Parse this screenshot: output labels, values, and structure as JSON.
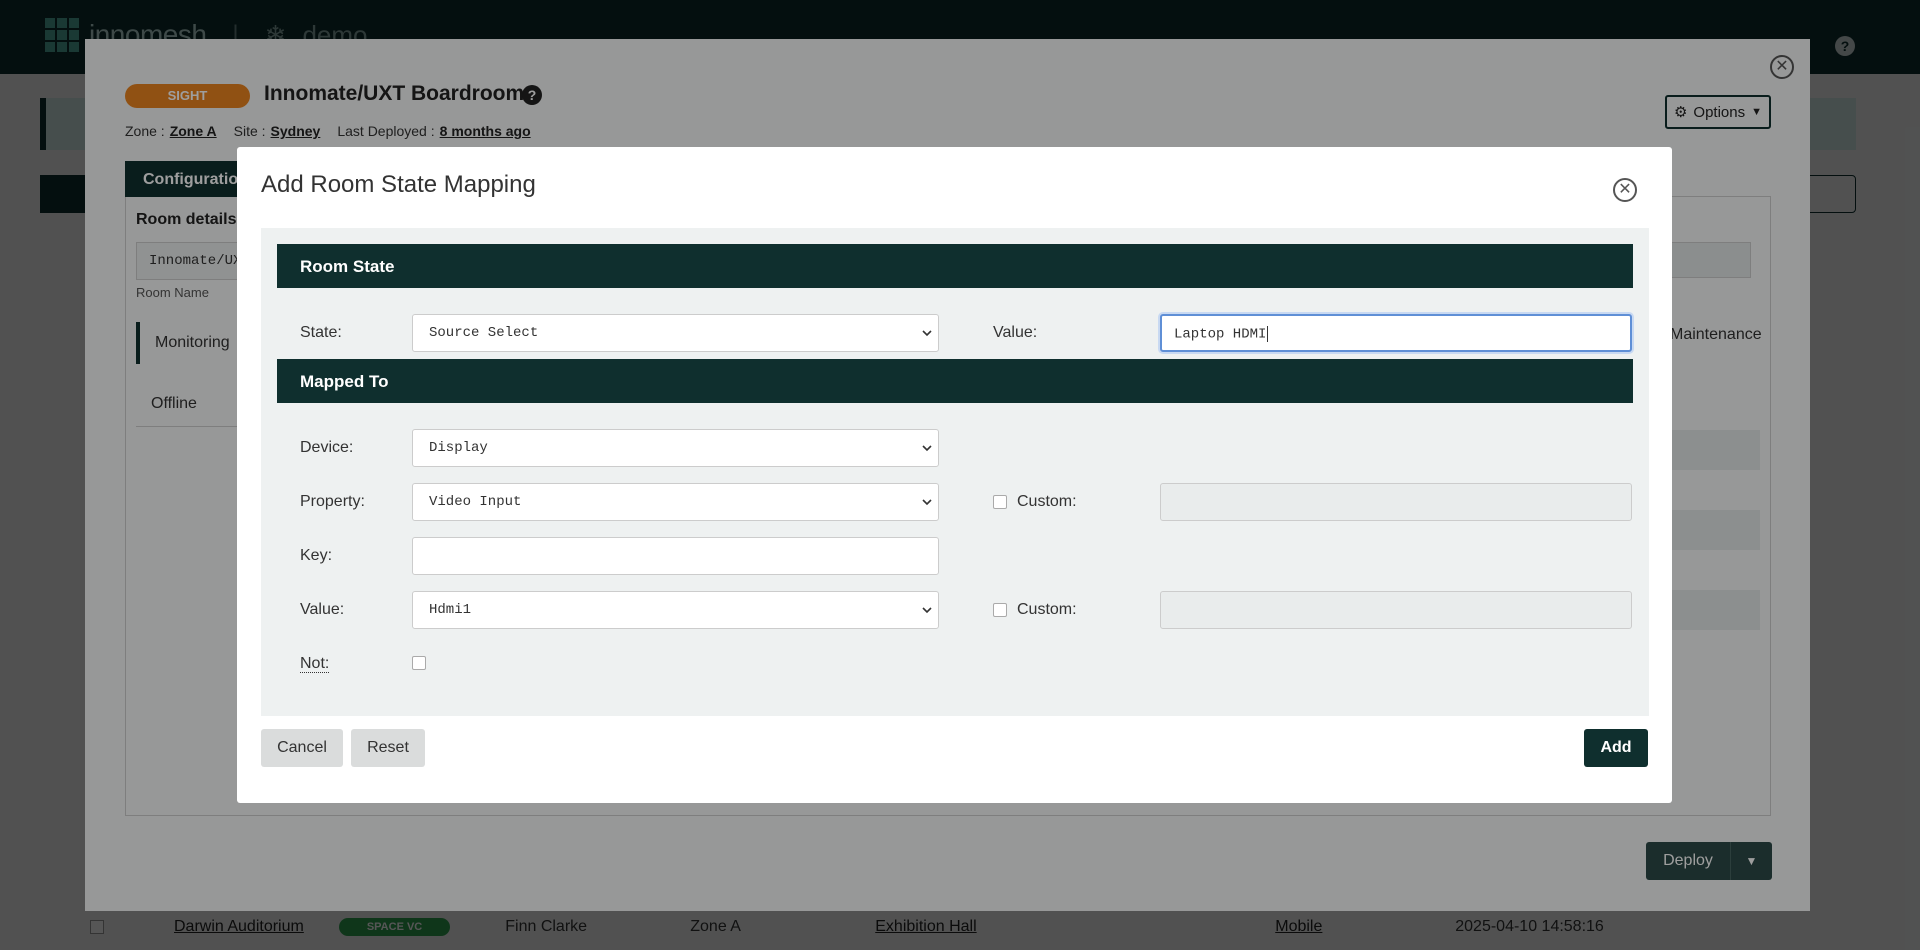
{
  "app": {
    "logo_text": "innomesh",
    "tenant": "demo"
  },
  "background": {
    "row": {
      "name": "Darwin Auditorium",
      "badge": "SPACE VC",
      "owner": "Finn Clarke",
      "zone": "Zone A",
      "site": "Exhibition Hall",
      "type": "Mobile",
      "timestamp": "2025-04-10 14:58:16"
    }
  },
  "room_modal": {
    "badge": "SIGHT",
    "title": "Innomate/UXT Boardroom",
    "meta": {
      "zone_label": "Zone :",
      "zone": "Zone A",
      "site_label": "Site :",
      "site": "Sydney",
      "deployed_label": "Last Deployed :",
      "deployed": "8 months ago"
    },
    "options_label": "Options",
    "config_tab": "Configuration",
    "room_details_label": "Room details",
    "room_name_value": "Innomate/UXT Boardroom",
    "room_name_label": "Room Name",
    "side_items": [
      "Monitoring",
      "Offline"
    ],
    "right_text": "Maintenance",
    "deploy_label": "Deploy"
  },
  "dialog": {
    "title": "Add Room State Mapping",
    "room_state_section": "Room State",
    "state_label": "State:",
    "state_value": "Source Select",
    "value_label": "Value:",
    "value_input": "Laptop HDMI",
    "mapped_to_section": "Mapped To",
    "device_label": "Device:",
    "device_value": "Display",
    "property_label": "Property:",
    "property_value": "Video Input",
    "custom_label": "Custom:",
    "key_label": "Key:",
    "key_value": "",
    "mapped_value_label": "Value:",
    "mapped_value": "Hdmi1",
    "not_label": "Not:",
    "cancel_label": "Cancel",
    "reset_label": "Reset",
    "add_label": "Add"
  },
  "colors": {
    "brand_dark": "#0f2f2e",
    "sight_badge": "#e8831f",
    "vc_badge": "#2e9e4f",
    "focus_border": "#5f8fd6"
  }
}
